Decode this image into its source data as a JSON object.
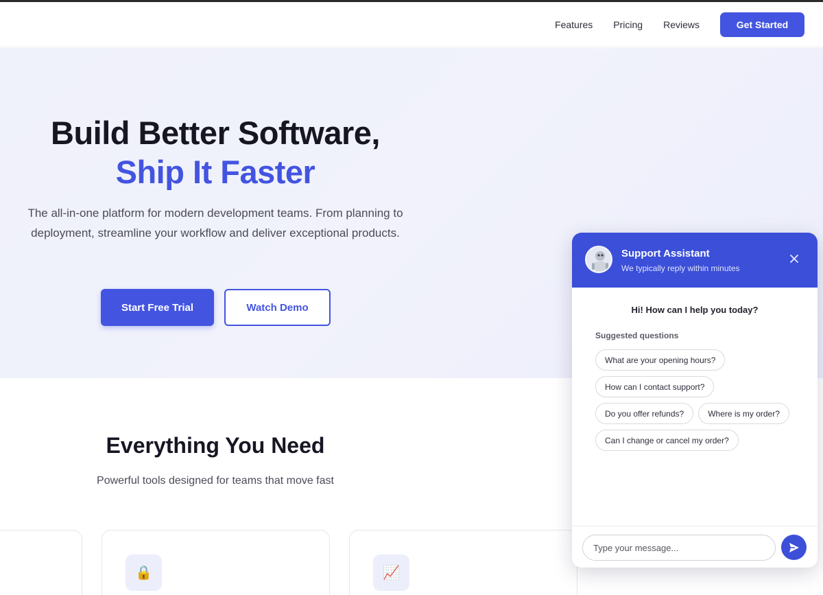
{
  "nav": {
    "links": [
      "Features",
      "Pricing",
      "Reviews"
    ],
    "cta_label": "Get Started"
  },
  "hero": {
    "title_line1": "Build Better Software,",
    "title_line2": "Ship It Faster",
    "subtitle": "The all-in-one platform for modern development teams. From planning to deployment, streamline your workflow and deliver exceptional products.",
    "primary_button": "Start Free Trial",
    "secondary_button": "Watch Demo"
  },
  "features": {
    "title": "Everything You Need",
    "subtitle": "Powerful tools designed for teams that move fast",
    "cards": [
      {
        "icon": "lock-icon",
        "glyph": "🔒"
      },
      {
        "icon": "chart-icon",
        "glyph": "📈"
      }
    ]
  },
  "chat": {
    "title": "Support Assistant",
    "status": "We typically reply within minutes",
    "greeting": "Hi! How can I help you today?",
    "suggested_label": "Suggested questions",
    "suggestions": [
      "What are your opening hours?",
      "How can I contact support?",
      "Do you offer refunds?",
      "Where is my order?",
      "Can I change or cancel my order?"
    ],
    "input_placeholder": "Type your message..."
  },
  "colors": {
    "accent": "#4354e0",
    "chat_header": "#3b4fd8"
  }
}
